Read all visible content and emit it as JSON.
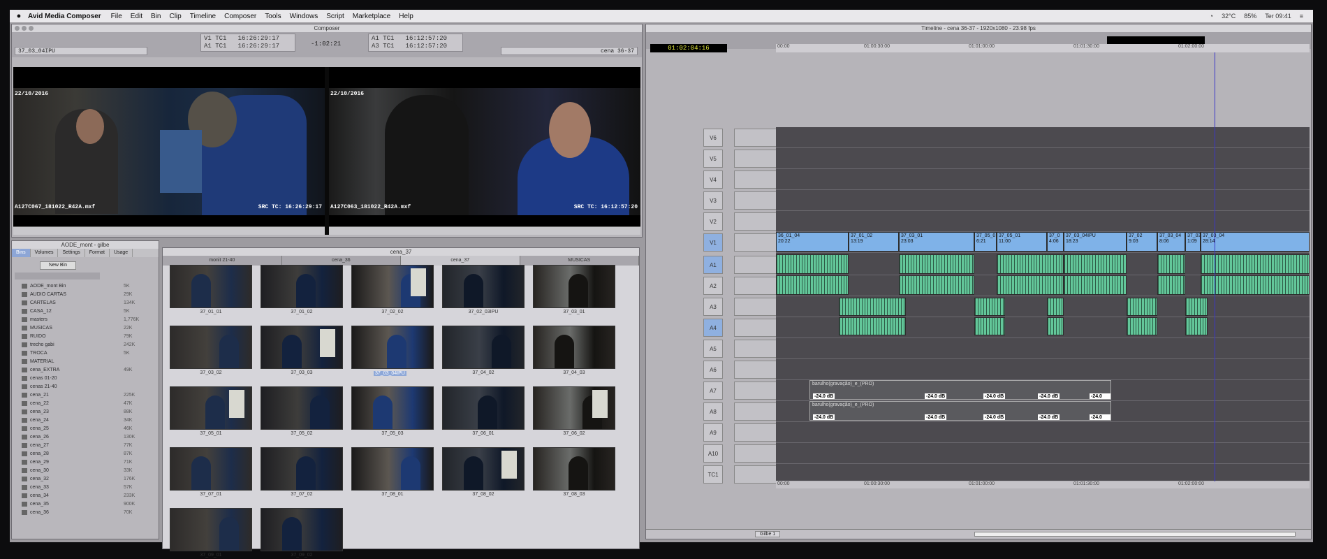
{
  "menubar": {
    "apple": "",
    "app_name": "Avid Media Composer",
    "items": [
      "File",
      "Edit",
      "Bin",
      "Clip",
      "Timeline",
      "Composer",
      "Tools",
      "Windows",
      "Script",
      "Marketplace",
      "Help"
    ],
    "status": [
      "32°C",
      "85%",
      "Ter 09:41"
    ]
  },
  "composer": {
    "title": "Composer",
    "source_clip": "37_03_04IPU",
    "record_sequence": "cena 36-37",
    "tc": {
      "v1_left": "V1 TC1",
      "v1_val": "16:26:29:17",
      "a1_left": "A1 TC1",
      "a1_val": "16:26:29:17",
      "dur": "-1:02:21",
      "a1_right": "A1 TC1",
      "a1_right_val": "16:12:57:20",
      "a3_right": "A3 TC1",
      "a3_right_val": "16:12:57:20"
    },
    "src_date": "22/10/2016",
    "rec_date": "22/10/2016",
    "src_file": "A127C067_181022_R42A.mxf",
    "src_tc": "SRC TC: 16:26:29:17",
    "rec_file": "A127C063_181022_R42A.mxf",
    "rec_tc": "SRC TC: 16:12:57:20"
  },
  "binlist": {
    "title": "AODE_mont - gilbe",
    "tabs": [
      "Bins",
      "Volumes",
      "Settings",
      "Format",
      "Usage"
    ],
    "new_bin": "New Bin",
    "rows": [
      {
        "name": "AODE_mont Bin",
        "size": "5K"
      },
      {
        "name": "AUDIO CARTAS",
        "size": "29K"
      },
      {
        "name": "CARTELAS",
        "size": "134K"
      },
      {
        "name": "CASA_12",
        "size": "5K"
      },
      {
        "name": "masters",
        "size": "1,776K"
      },
      {
        "name": "MUSICAS",
        "size": "22K"
      },
      {
        "name": "RUIDO",
        "size": "79K"
      },
      {
        "name": "trecho gabi",
        "size": "242K"
      },
      {
        "name": "TROCA",
        "size": "5K"
      },
      {
        "name": "MATERIAL",
        "size": ""
      },
      {
        "name": "cena_EXTRA",
        "size": "49K"
      },
      {
        "name": "cenas 01-20",
        "size": ""
      },
      {
        "name": "cenas 21-40",
        "size": ""
      },
      {
        "name": "cena_21",
        "size": "225K"
      },
      {
        "name": "cena_22",
        "size": "47K"
      },
      {
        "name": "cena_23",
        "size": "88K"
      },
      {
        "name": "cena_24",
        "size": "34K"
      },
      {
        "name": "cena_25",
        "size": "46K"
      },
      {
        "name": "cena_26",
        "size": "130K"
      },
      {
        "name": "cena_27",
        "size": "77K"
      },
      {
        "name": "cena_28",
        "size": "87K"
      },
      {
        "name": "cena_29",
        "size": "71K"
      },
      {
        "name": "cena_30",
        "size": "33K"
      },
      {
        "name": "cena_32",
        "size": "176K"
      },
      {
        "name": "cena_33",
        "size": "57K"
      },
      {
        "name": "cena_34",
        "size": "233K"
      },
      {
        "name": "cena_35",
        "size": "900K"
      },
      {
        "name": "cena_36",
        "size": "70K"
      }
    ]
  },
  "bin": {
    "title": "cena_37",
    "tabs": [
      "monit 21-40",
      "cena_36",
      "cena_37",
      "MUSICAS"
    ],
    "clips": [
      "37_01_01",
      "37_01_02",
      "37_02_02",
      "37_02_03IPU",
      "37_03_01",
      "37_03_02",
      "37_03_03",
      "37_03_04IPU",
      "37_04_02",
      "37_04_03",
      "37_05_01",
      "37_05_02",
      "37_05_03",
      "37_06_01",
      "37_06_02",
      "37_07_01",
      "37_07_02",
      "37_08_01",
      "37_08_02",
      "37_08_03",
      "37_09_01",
      "37_09_02"
    ]
  },
  "timeline": {
    "title": "Timeline - cena 36-37 - 1920x1080 - 23.98 fps",
    "master_tc": "01:02:04:16",
    "ruler": [
      "00:00",
      "01:00:30:00",
      "01:01:00:00",
      "01:01:30:00",
      "01:02:00:00"
    ],
    "tracks": [
      "V6",
      "V5",
      "V4",
      "V3",
      "V2",
      "V1",
      "A1",
      "A2",
      "A3",
      "A4",
      "A5",
      "A6",
      "A7",
      "A8",
      "A9",
      "A10",
      "TC1"
    ],
    "v1_clips": [
      {
        "name": "36_01_04",
        "tc": "20:22"
      },
      {
        "name": "37_01_02",
        "tc": "13:19"
      },
      {
        "name": "37_03_01",
        "tc": "23:03"
      },
      {
        "name": "37_05_0",
        "tc": "6:21"
      },
      {
        "name": "37_05_01",
        "tc": "11:00"
      },
      {
        "name": "37_0",
        "tc": "4:06"
      },
      {
        "name": "37_03_04IPU",
        "tc": "18:23"
      },
      {
        "name": "37_02",
        "tc": "9:03"
      },
      {
        "name": "37_03_04",
        "tc": "8:06"
      },
      {
        "name": "37_03",
        "tc": "1:09"
      },
      {
        "name": "37_03_04",
        "tc": "28:14"
      }
    ],
    "music_label": "barulho(gravação)_e_(PRO)",
    "db_label": "-24.0 dB",
    "bin_name": "Gilbe 1"
  }
}
